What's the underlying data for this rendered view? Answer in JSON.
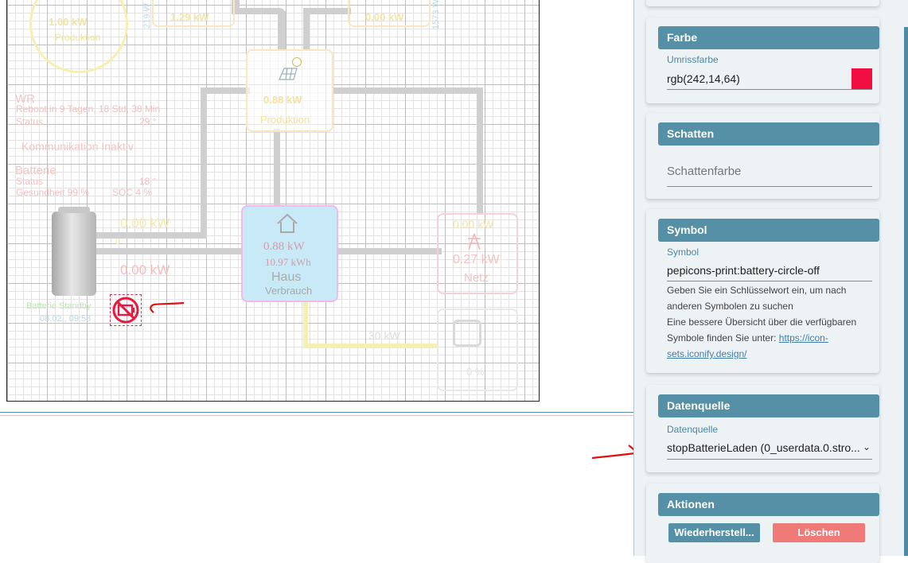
{
  "canvas": {
    "wr_title": "WR",
    "wr_reboot": "Reboot in 9 Tagen, 18 Std, 38 Min",
    "wr_status": "Status",
    "wr_temp": "29 °",
    "komm": "Kommunikation Inaktiv",
    "batt_title": "Batterie",
    "batt_status": "Status",
    "batt_temp": "18 °",
    "batt_health": "Gesundheit 99 %",
    "batt_soc": "SOC 4 %",
    "kw_top1": "1.29 kW",
    "kw_top2": "0.00 kW",
    "kw_circle": "1.00 kW",
    "circle_label": "Produktion",
    "side_num1": "219 W",
    "side_num2": "1573 W",
    "pv_kw": "0.88 kW",
    "pv_label": "Produktion",
    "batt_kw1": "0.00 kW",
    "batt_kw2": "0.00 kW",
    "batt_zero": "0",
    "haus_kw": "0.88 kW",
    "haus_kwh": "10.97 kWh",
    "haus_label": "Haus",
    "haus_sub": "Verbrauch",
    "netz_kw1": "0.00 kW",
    "netz_kw2": "0.27 kW",
    "netz_label": "Netz",
    "batt_standby": "Batterie Standby",
    "batt_time": "08.02., 09:58",
    "wallbox_val": "30 kW",
    "wallbox_sub": "0 %",
    "colors": {
      "selection": "#e8193f",
      "annotation": "#e01010"
    }
  },
  "panel": {
    "farbe": {
      "title": "Farbe",
      "label": "Umrissfarbe",
      "value": "rgb(242,14,64)",
      "swatch": "#f20e40"
    },
    "schatten": {
      "title": "Schatten",
      "placeholder": "Schattenfarbe"
    },
    "symbol": {
      "title": "Symbol",
      "label": "Symbol",
      "value": "pepicons-print:battery-circle-off",
      "help1": "Geben Sie ein Schlüsselwort ein, um nach anderen Symbolen zu suchen",
      "help2": "Eine bessere Übersicht über die verfügbaren Symbole finden Sie unter:",
      "link": "https://icon-sets.iconify.design/"
    },
    "datenquelle": {
      "title": "Datenquelle",
      "label": "Datenquelle",
      "value": "stopBatterieLaden (0_userdata.0.stro..."
    },
    "aktionen": {
      "title": "Aktionen",
      "restore": "Wiederherstell...",
      "delete": "Löschen"
    }
  }
}
